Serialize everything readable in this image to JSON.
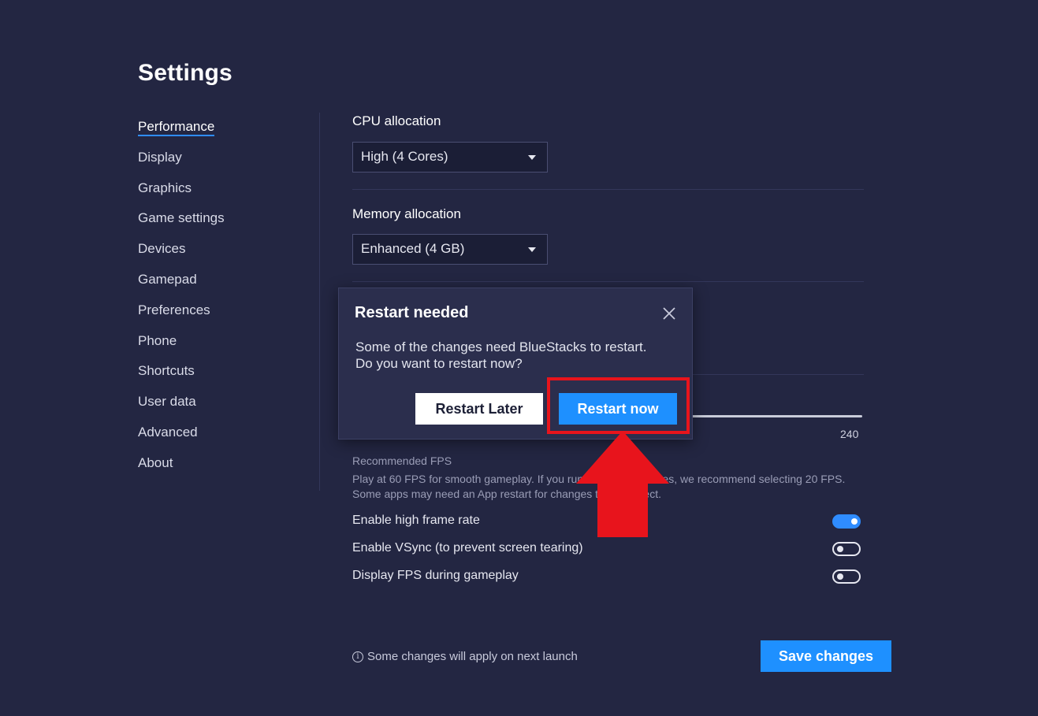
{
  "page": {
    "title": "Settings"
  },
  "sidebar": {
    "items": [
      {
        "label": "Performance",
        "active": true
      },
      {
        "label": "Display"
      },
      {
        "label": "Graphics"
      },
      {
        "label": "Game settings"
      },
      {
        "label": "Devices"
      },
      {
        "label": "Gamepad"
      },
      {
        "label": "Preferences"
      },
      {
        "label": "Phone"
      },
      {
        "label": "Shortcuts"
      },
      {
        "label": "User data"
      },
      {
        "label": "Advanced"
      },
      {
        "label": "About"
      }
    ]
  },
  "performance": {
    "cpu": {
      "label": "CPU allocation",
      "value": "High (4 Cores)"
    },
    "memory": {
      "label": "Memory allocation",
      "value": "Enhanced (4 GB)"
    },
    "fps": {
      "max_tick": "240",
      "recommended_title": "Recommended FPS",
      "recommended_text": "Play at 60 FPS for smooth gameplay. If you run multiple instances, we recommend selecting 20 FPS. Some apps may need an App restart for changes to take effect."
    },
    "toggles": [
      {
        "label": "Enable high frame rate",
        "on": true
      },
      {
        "label": "Enable VSync (to prevent screen tearing)",
        "on": false
      },
      {
        "label": "Display FPS during gameplay",
        "on": false
      }
    ]
  },
  "footer": {
    "note": "Some changes will apply on next launch",
    "save_label": "Save changes"
  },
  "dialog": {
    "title": "Restart needed",
    "body_line1": "Some of the changes need BlueStacks to restart.",
    "body_line2": "Do you want to restart now?",
    "later_label": "Restart Later",
    "now_label": "Restart now"
  },
  "colors": {
    "background": "#232642",
    "accent": "#1e90ff",
    "highlight": "#e8141c"
  },
  "icons": [
    "chevron-down-icon",
    "close-icon",
    "info-icon",
    "arrow-up-icon"
  ]
}
